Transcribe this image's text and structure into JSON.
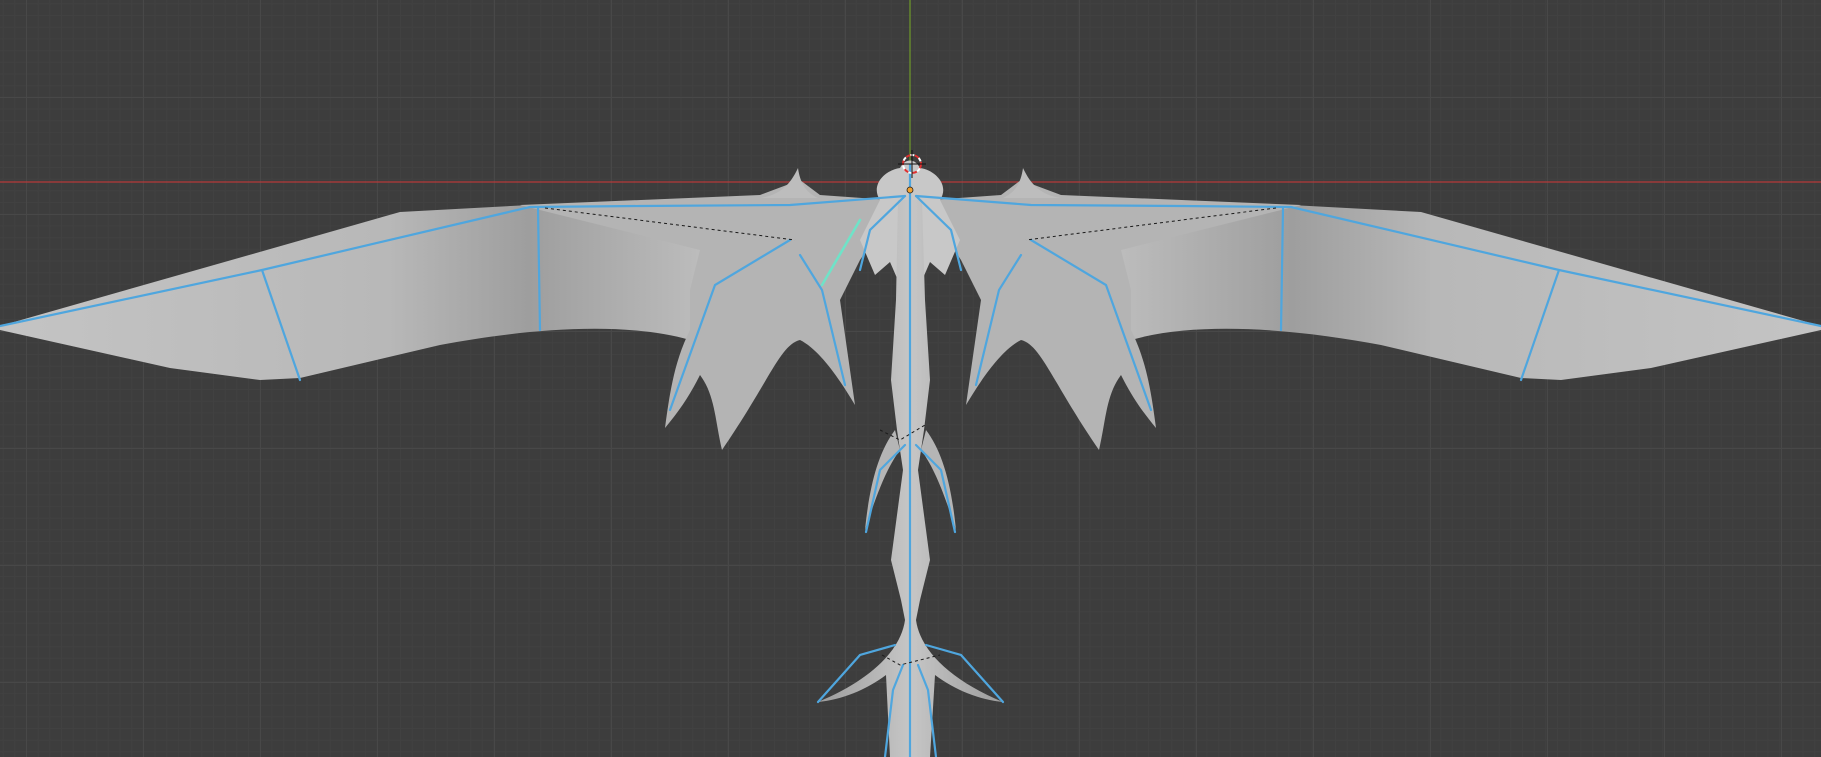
{
  "app": {
    "name": "3D Viewport",
    "view": "top-orthographic",
    "colors": {
      "background": "#3d3d3d",
      "grid_major": "#484848",
      "grid_minor": "#414141",
      "axis_x": "#b53a3a",
      "axis_y": "#6f9a2a",
      "mesh_fill": "#b9b9b9",
      "mesh_shade": "#9a9a9a",
      "bone": "#4fa6de",
      "active_bone": "#6fe3c8",
      "relationship_line": "#1a1a1a",
      "cursor_red": "#e03030",
      "cursor_white": "#ffffff"
    }
  },
  "scene": {
    "objects": [
      {
        "name": "dragon-mesh",
        "type": "mesh",
        "shading": "solid"
      },
      {
        "name": "dragon-armature",
        "type": "armature",
        "display": "stick"
      }
    ],
    "icons": [
      "3d-cursor-icon",
      "origin-icon"
    ]
  }
}
